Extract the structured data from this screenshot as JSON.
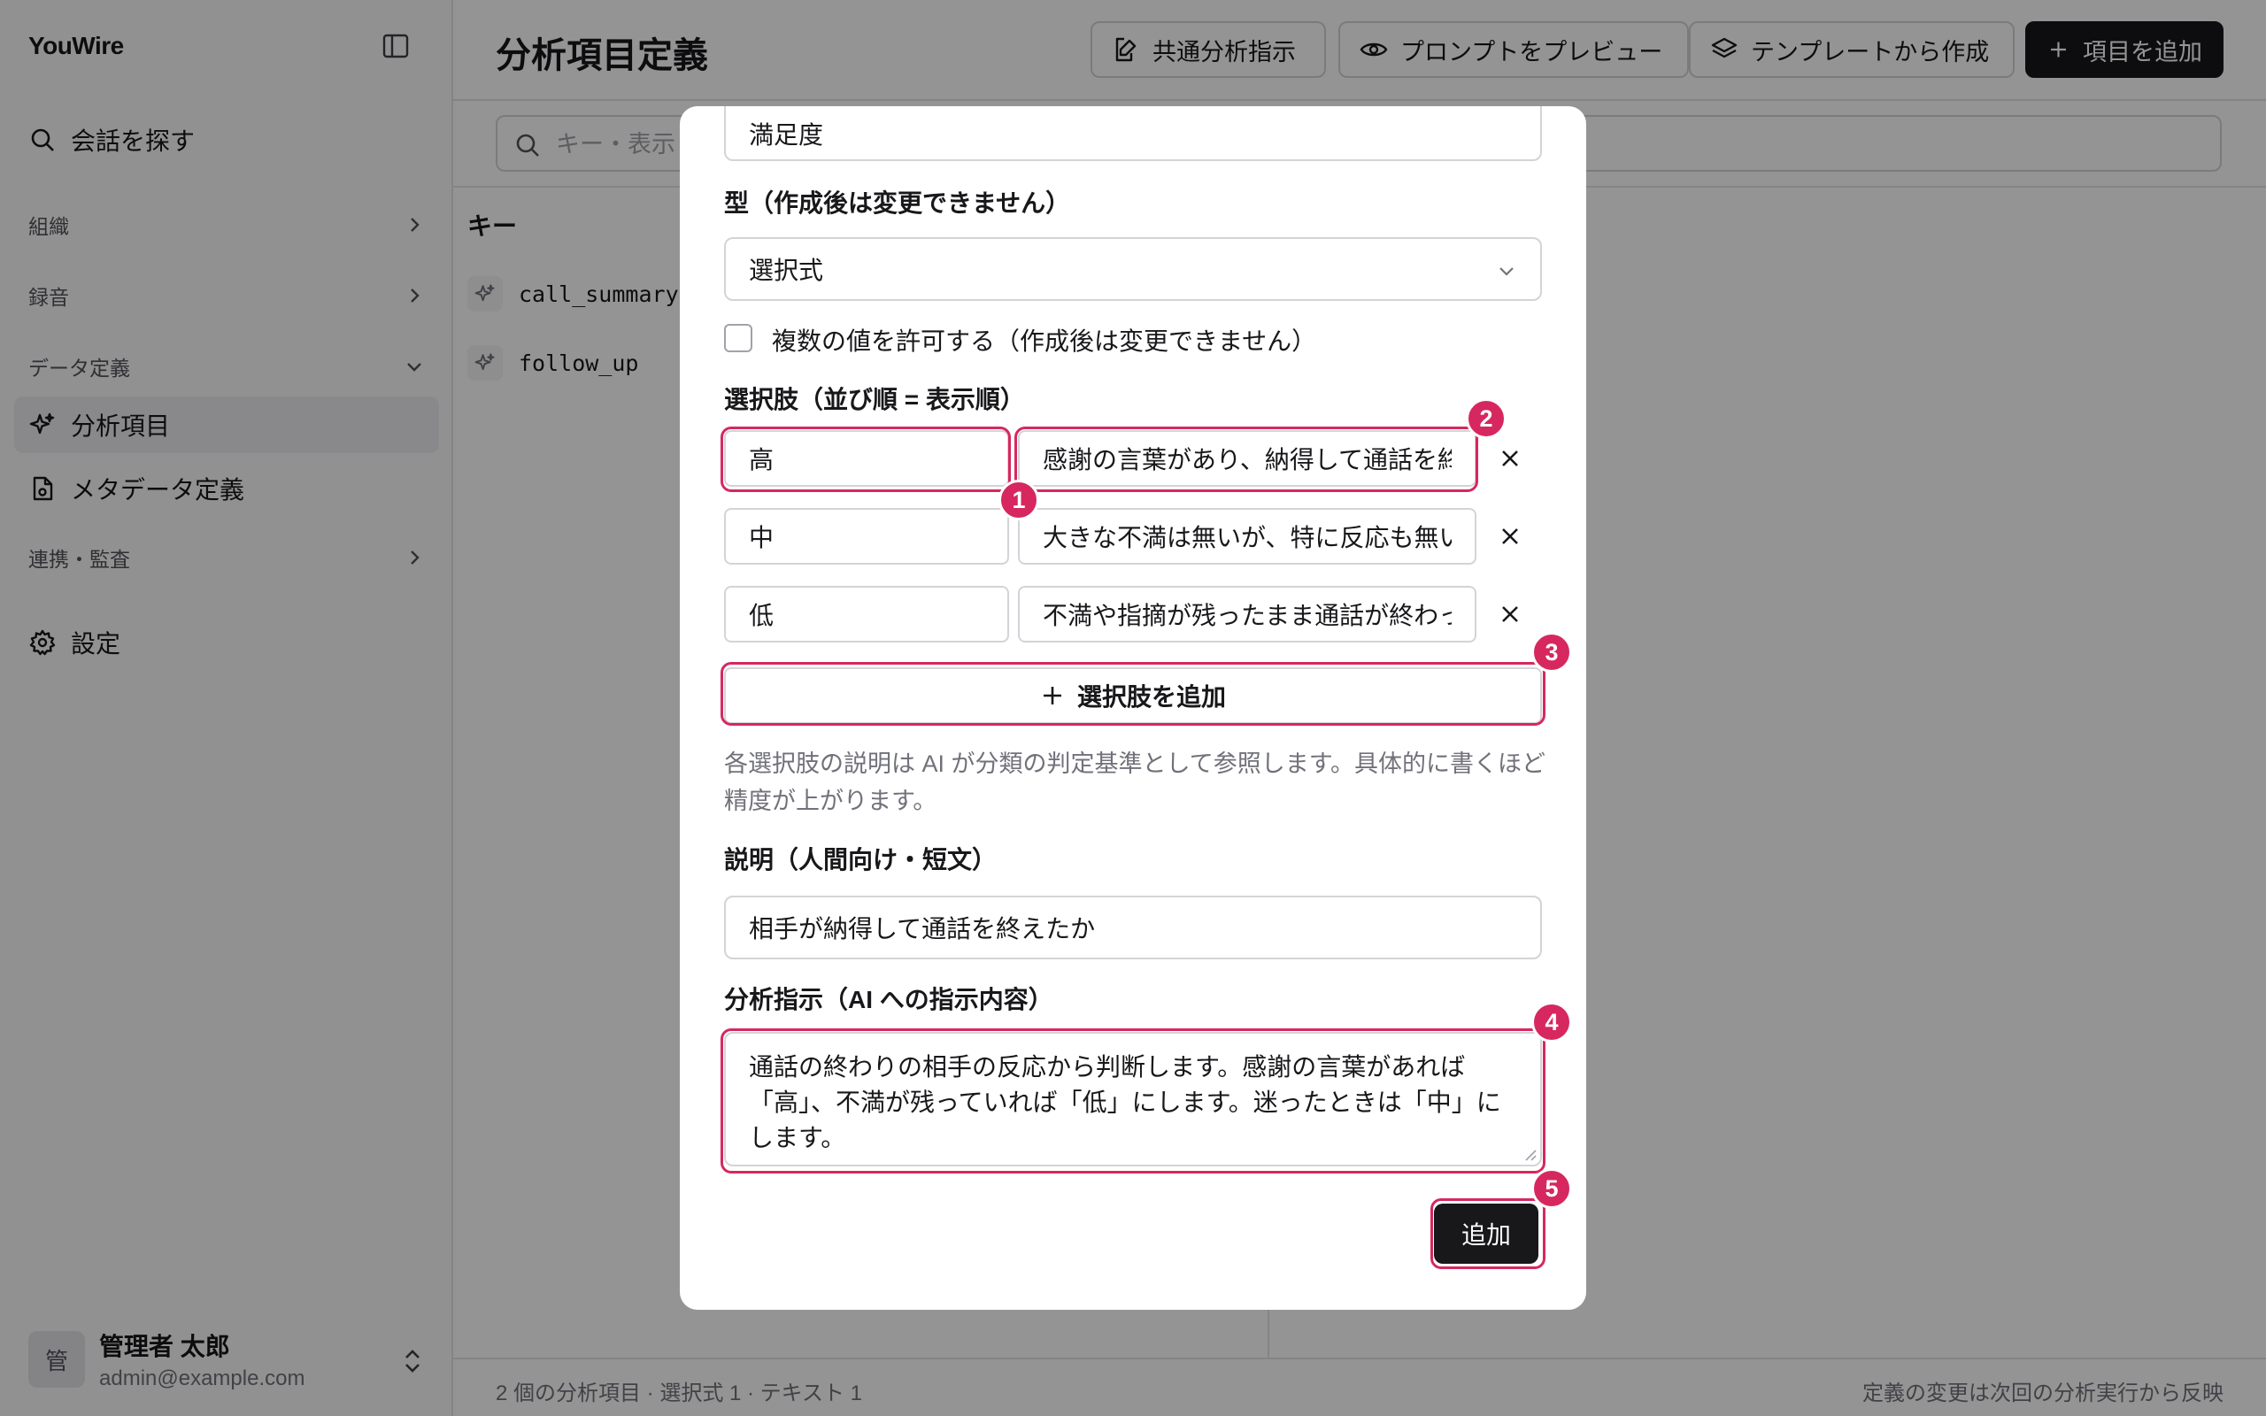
{
  "sidebar": {
    "brand": "YouWire",
    "search_label": "会話を探す",
    "section_org": "組織",
    "section_recording": "録音",
    "section_data": "データ定義",
    "item_analysis": "分析項目",
    "item_metadata": "メタデータ定義",
    "section_integration": "連携・監査",
    "item_settings": "設定",
    "user_initial": "管",
    "user_name": "管理者 太郎",
    "user_email": "admin@example.com"
  },
  "header": {
    "title": "分析項目定義",
    "common_instructions": "共通分析指示",
    "preview_prompt": "プロンプトをプレビュー",
    "from_template": "テンプレートから作成",
    "add_item": "項目を追加"
  },
  "search": {
    "placeholder": "キー・表示"
  },
  "table": {
    "key_header": "キー",
    "rows": [
      "call_summary",
      "follow_up"
    ]
  },
  "footer": {
    "summary": "2 個の分析項目 · 選択式 1 · テキスト 1",
    "note": "定義の変更は次回の分析実行から反映"
  },
  "dialog": {
    "display_name_value": "満足度",
    "type_label": "型（作成後は変更できません）",
    "type_value": "選択式",
    "multi_label": "複数の値を許可する（作成後は変更できません）",
    "multi_checked": false,
    "options_label": "選択肢（並び順 = 表示順）",
    "options": [
      {
        "value": "高",
        "description": "感謝の言葉があり、納得して通話を終"
      },
      {
        "value": "中",
        "description": "大きな不満は無いが、特に反応も無い"
      },
      {
        "value": "低",
        "description": "不満や指摘が残ったまま通話が終わっ"
      }
    ],
    "add_option": "選択肢を追加",
    "options_help": "各選択肢の説明は AI が分類の判定基準として参照します。具体的に書くほど精度が上がります。",
    "description_label": "説明（人間向け・短文）",
    "description_value": "相手が納得して通話を終えたか",
    "instruction_label": "分析指示（AI への指示内容）",
    "instruction_value": "通話の終わりの相手の反応から判断します。感謝の言葉があれば「高」、不満が残っていれば「低」にします。迷ったときは「中」にします。",
    "submit": "追加"
  },
  "callouts": [
    "1",
    "2",
    "3",
    "4",
    "5"
  ],
  "colors": {
    "accent": "#d6285e",
    "primary": "#18181b",
    "overlay": "rgba(0,0,0,0.42)"
  }
}
